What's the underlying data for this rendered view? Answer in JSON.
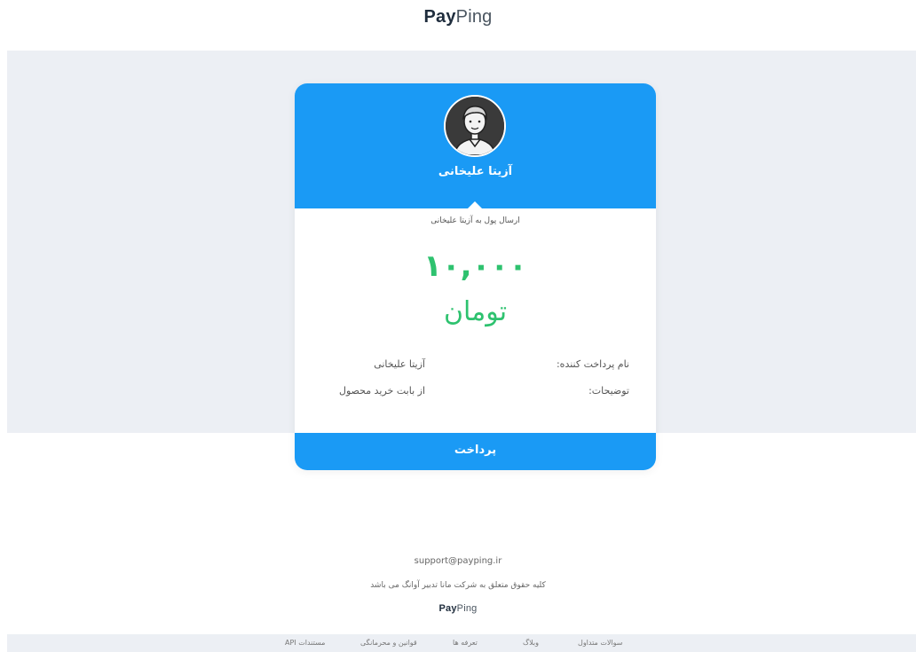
{
  "header": {
    "logo": {
      "pay": "Pay",
      "ping": "Ping"
    }
  },
  "card": {
    "owner_name": "آزیتا علیخانی",
    "send_label": "ارسال پول به آزیتا علیخانی",
    "amount": "۱۰,۰۰۰",
    "currency": "تومان",
    "payer_label": "نام پرداخت کننده:",
    "payer_value": "آزیتا علیخانی",
    "description_label": "توضیحات:",
    "description_value": "از بابت خرید محصول",
    "pay_button": "پرداخت"
  },
  "footer": {
    "support_email": "support@payping.ir",
    "copyright": "کلیه حقوق متعلق به شرکت مانا تدبیر آوانگ می باشد",
    "logo": {
      "pay": "Pay",
      "ping": "Ping"
    },
    "links": [
      "سوالات متداول",
      "وبلاگ",
      "تعرفه ها",
      "قوانین و محرمانگی",
      "API مستندات"
    ]
  },
  "colors": {
    "brand_blue": "#1a9af5",
    "amount_green": "#2ec26f",
    "band_gray": "#eceff4"
  },
  "icons": {
    "avatar": "user-avatar-icon"
  }
}
